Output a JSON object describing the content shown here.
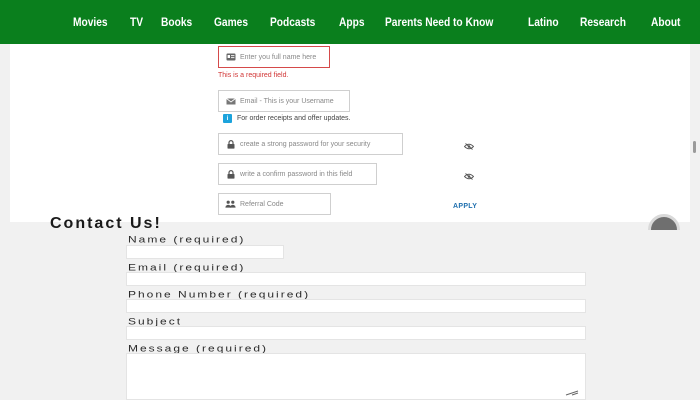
{
  "nav": {
    "items": [
      "Movies",
      "TV",
      "Books",
      "Games",
      "Podcasts",
      "Apps",
      "Parents Need to Know",
      "Latino",
      "Research",
      "About"
    ]
  },
  "signup": {
    "name_placeholder": "Enter you full name here",
    "name_error": "This is a required field.",
    "email_placeholder": "Email - This is your Username",
    "email_hint": "For order receipts and offer updates.",
    "password_placeholder": "create a strong password for your security",
    "confirm_placeholder": "write a confirm password in this field",
    "referral_placeholder": "Referral Code",
    "apply_label": "APPLY"
  },
  "contact": {
    "title": "Contact Us!",
    "name_label": "Name (required)",
    "email_label": "Email (required)",
    "phone_label": "Phone Number (required)",
    "subject_label": "Subject",
    "message_label": "Message (required)"
  },
  "colors": {
    "nav_bg": "#0a7f1d",
    "error": "#d13636",
    "info": "#1ca3dc",
    "apply": "#1f6fae"
  }
}
